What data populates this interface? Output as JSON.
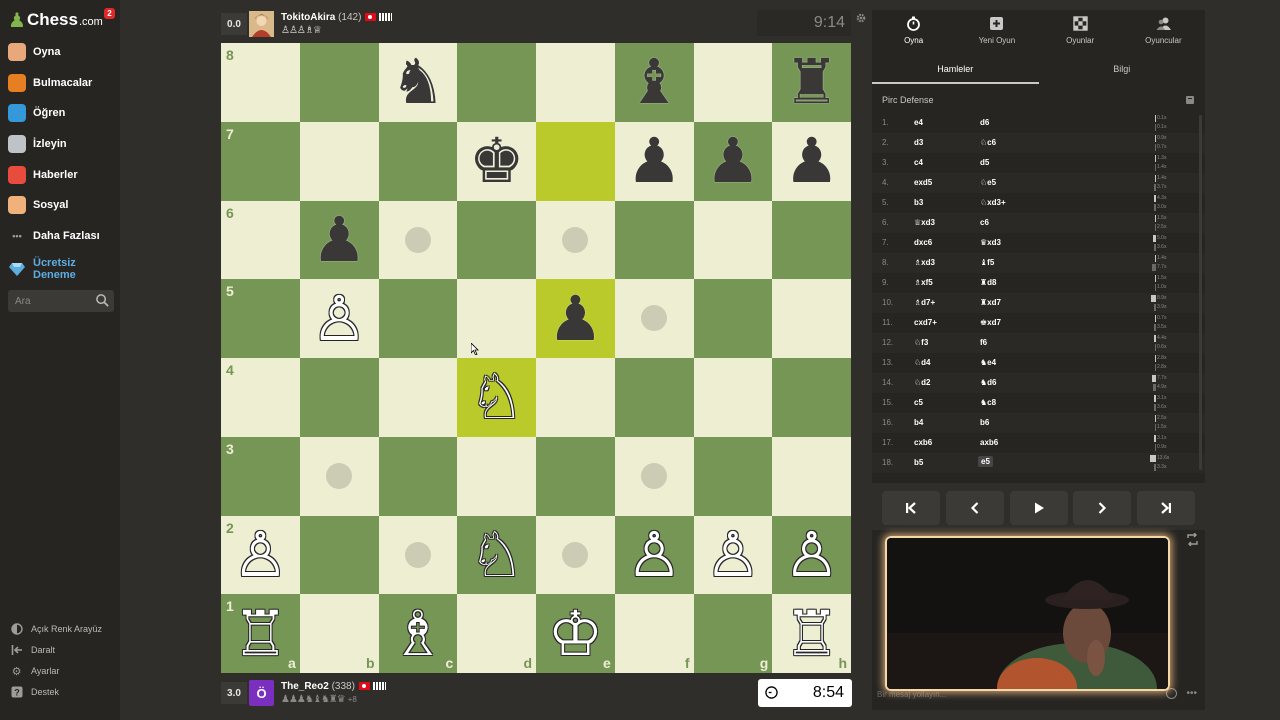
{
  "app": {
    "logo_text": "Chess",
    "logo_suffix": ".com",
    "notification_count": "2"
  },
  "sidebar": {
    "items": [
      {
        "label": "Oyna",
        "icon": "play-hand-icon",
        "color": "#e8a87c"
      },
      {
        "label": "Bulmacalar",
        "icon": "puzzle-icon",
        "color": "#e67e22"
      },
      {
        "label": "Öğren",
        "icon": "learn-icon",
        "color": "#3498db"
      },
      {
        "label": "İzleyin",
        "icon": "binoculars-icon",
        "color": "#bdc3c7"
      },
      {
        "label": "Haberler",
        "icon": "news-icon",
        "color": "#e74c3c"
      },
      {
        "label": "Sosyal",
        "icon": "social-icon",
        "color": "#f0b27a"
      },
      {
        "label": "Daha Fazlası",
        "icon": "more-icon",
        "color": "#9e9c9a"
      }
    ],
    "try_free": {
      "line1": "Ücretsiz",
      "line2": "Deneme",
      "icon": "diamond-icon",
      "color": "#5dade2"
    },
    "search_placeholder": "Ara",
    "bottom": [
      {
        "label": "Açık Renk Arayüz",
        "icon": "half-circle-icon"
      },
      {
        "label": "Daralt",
        "icon": "collapse-icon"
      },
      {
        "label": "Ayarlar",
        "icon": "gear-icon"
      },
      {
        "label": "Destek",
        "icon": "help-icon"
      }
    ]
  },
  "top_player": {
    "score": "0.0",
    "name": "TokitoAkira",
    "rating": "(142)",
    "captured": "♙♙♙♗♕",
    "clock": "9:14"
  },
  "bottom_player": {
    "score": "3.0",
    "avatar_letter": "Ö",
    "avatar_color": "#7b2fbe",
    "name": "The_Reo2",
    "rating": "(338)",
    "captured": "♟♟♟♞♝♞♜♛",
    "advantage": "+8",
    "clock": "8:54"
  },
  "board": {
    "colors": {
      "light": "#eeeed2",
      "dark": "#769656",
      "highlight_light": "#f6f669",
      "highlight_dark": "#baca2b"
    },
    "ranks": [
      "8",
      "7",
      "6",
      "5",
      "4",
      "3",
      "2",
      "1"
    ],
    "files": [
      "a",
      "b",
      "c",
      "d",
      "e",
      "f",
      "g",
      "h"
    ],
    "pieces": [
      {
        "sq": "c8",
        "p": "♞",
        "side": "b"
      },
      {
        "sq": "f8",
        "p": "♝",
        "side": "b"
      },
      {
        "sq": "h8",
        "p": "♜",
        "side": "b"
      },
      {
        "sq": "d7",
        "p": "♚",
        "side": "b"
      },
      {
        "sq": "f7",
        "p": "♟",
        "side": "b"
      },
      {
        "sq": "g7",
        "p": "♟",
        "side": "b"
      },
      {
        "sq": "h7",
        "p": "♟",
        "side": "b"
      },
      {
        "sq": "b6",
        "p": "♟",
        "side": "b"
      },
      {
        "sq": "b5",
        "p": "♙",
        "side": "w"
      },
      {
        "sq": "e5",
        "p": "♟",
        "side": "b"
      },
      {
        "sq": "d4",
        "p": "♘",
        "side": "w"
      },
      {
        "sq": "a2",
        "p": "♙",
        "side": "w"
      },
      {
        "sq": "d2",
        "p": "♘",
        "side": "w"
      },
      {
        "sq": "f2",
        "p": "♙",
        "side": "w"
      },
      {
        "sq": "g2",
        "p": "♙",
        "side": "w"
      },
      {
        "sq": "h2",
        "p": "♙",
        "side": "w"
      },
      {
        "sq": "a1",
        "p": "♖",
        "side": "w"
      },
      {
        "sq": "c1",
        "p": "♗",
        "side": "w"
      },
      {
        "sq": "e1",
        "p": "♔",
        "side": "w"
      },
      {
        "sq": "h1",
        "p": "♖",
        "side": "w"
      }
    ],
    "highlights": [
      "e7",
      "e5",
      "d4"
    ],
    "hints": [
      "c6",
      "e6",
      "f5",
      "b3",
      "f3",
      "c2",
      "e2"
    ]
  },
  "panel": {
    "tabs": [
      {
        "label": "Oyna",
        "icon": "stopwatch-icon",
        "active": true
      },
      {
        "label": "Yeni Oyun",
        "icon": "plus-icon",
        "active": false
      },
      {
        "label": "Oyunlar",
        "icon": "board-icon",
        "active": false
      },
      {
        "label": "Oyuncular",
        "icon": "players-icon",
        "active": false
      }
    ],
    "subtabs": [
      {
        "label": "Hamleler",
        "active": true
      },
      {
        "label": "Bilgi",
        "active": false
      }
    ],
    "opening": "Pirc Defense",
    "moves": [
      {
        "n": "1.",
        "w": "e4",
        "b": "d6",
        "tw": "0.1s",
        "tb": "0.1s",
        "bw": 0.05,
        "bb": 0.05
      },
      {
        "n": "2.",
        "w": "d3",
        "b": "♘c6",
        "tw": "0.9s",
        "tb": "0.7s",
        "bw": 0.1,
        "bb": 0.1
      },
      {
        "n": "3.",
        "w": "c4",
        "b": "d5",
        "tw": "1.3s",
        "tb": "1.4s",
        "bw": 0.15,
        "bb": 0.15
      },
      {
        "n": "4.",
        "w": "exd5",
        "b": "♘e5",
        "tw": "1.4s",
        "tb": "3.7s",
        "bw": 0.15,
        "bb": 0.35
      },
      {
        "n": "5.",
        "w": "b3",
        "b": "♘xd3+",
        "tw": "4.3s",
        "tb": "3.0s",
        "bw": 0.4,
        "bb": 0.3
      },
      {
        "n": "6.",
        "w": "♕xd3",
        "b": "c6",
        "tw": "1.5s",
        "tb": "2.5s",
        "bw": 0.15,
        "bb": 0.25
      },
      {
        "n": "7.",
        "w": "dxc6",
        "b": "♛xd3",
        "tw": "5.0s",
        "tb": "3.6s",
        "bw": 0.45,
        "bb": 0.35
      },
      {
        "n": "8.",
        "w": "♗xd3",
        "b": "♝f5",
        "tw": "1.4s",
        "tb": "7.7s",
        "bw": 0.15,
        "bb": 0.7
      },
      {
        "n": "9.",
        "w": "♗xf5",
        "b": "♜d8",
        "tw": "1.5s",
        "tb": "1.0s",
        "bw": 0.15,
        "bb": 0.1
      },
      {
        "n": "10.",
        "w": "♗d7+",
        "b": "♜xd7",
        "tw": "8.9s",
        "tb": "3.9s",
        "bw": 0.8,
        "bb": 0.35
      },
      {
        "n": "11.",
        "w": "cxd7+",
        "b": "♚xd7",
        "tw": "0.7s",
        "tb": "3.5s",
        "bw": 0.1,
        "bb": 0.3
      },
      {
        "n": "12.",
        "w": "♘f3",
        "b": "f6",
        "tw": "4.4s",
        "tb": "0.6s",
        "bw": 0.4,
        "bb": 0.1
      },
      {
        "n": "13.",
        "w": "♘d4",
        "b": "♞e4",
        "tw": "2.8s",
        "tb": "2.8s",
        "bw": 0.25,
        "bb": 0.25
      },
      {
        "n": "14.",
        "w": "♘d2",
        "b": "♞d6",
        "tw": "7.7s",
        "tb": "4.9s",
        "bw": 0.7,
        "bb": 0.45
      },
      {
        "n": "15.",
        "w": "c5",
        "b": "♞c8",
        "tw": "3.1s",
        "tb": "3.6s",
        "bw": 0.3,
        "bb": 0.35
      },
      {
        "n": "16.",
        "w": "b4",
        "b": "b6",
        "tw": "2.5s",
        "tb": "1.5s",
        "bw": 0.25,
        "bb": 0.15
      },
      {
        "n": "17.",
        "w": "cxb6",
        "b": "axb6",
        "tw": "3.1s",
        "tb": "0.9s",
        "bw": 0.3,
        "bb": 0.1
      },
      {
        "n": "18.",
        "w": "b5",
        "b": "e5",
        "tw": "13.6s",
        "tb": "3.3s",
        "bw": 1.0,
        "bb": 0.3
      }
    ],
    "controls": [
      {
        "name": "first-move-button",
        "icon": "skip-back-icon"
      },
      {
        "name": "previous-move-button",
        "icon": "chevron-left-icon"
      },
      {
        "name": "play-button",
        "icon": "play-icon"
      },
      {
        "name": "next-move-button",
        "icon": "chevron-right-icon"
      },
      {
        "name": "last-move-button",
        "icon": "skip-forward-icon"
      }
    ],
    "chat_placeholder": "Bir mesaj yollayın...",
    "chat_more": "•••"
  }
}
